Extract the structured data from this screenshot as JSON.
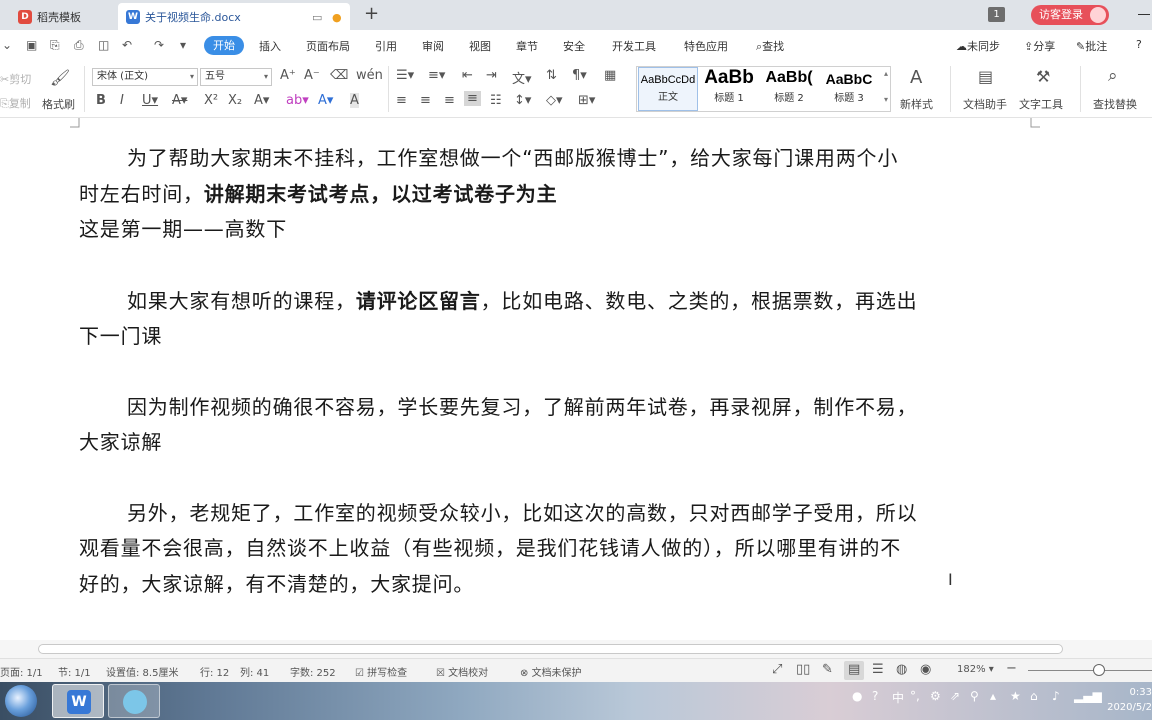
{
  "tabs": [
    {
      "label": "稻壳模板",
      "icon": "daoke-logo-icon",
      "color": "#e14b3f"
    },
    {
      "label": "关于视频生命.docx",
      "icon": "wps-writer-icon",
      "color": "#3778d6",
      "active": true
    }
  ],
  "titlebar": {
    "window_badge": "1",
    "guest_login": "访客登录"
  },
  "menu": {
    "items": [
      "开始",
      "插入",
      "页面布局",
      "引用",
      "审阅",
      "视图",
      "章节",
      "安全",
      "开发工具",
      "特色应用"
    ],
    "search_label": "查找",
    "right_items": [
      "未同步",
      "分享",
      "批注"
    ]
  },
  "ribbon": {
    "cut": "剪切",
    "copy": "复制",
    "format_painter": "格式刷",
    "font_name": "宋体 (正文)",
    "font_size": "五号",
    "styles": [
      {
        "sample": "AaBbCcDd",
        "name": "正文"
      },
      {
        "sample": "AaBb",
        "name": "标题 1"
      },
      {
        "sample": "AaBb(",
        "name": "标题 2"
      },
      {
        "sample": "AaBbC",
        "name": "标题 3"
      }
    ],
    "new_style": "新样式",
    "doc_assistant": "文档助手",
    "text_tools": "文字工具",
    "find_replace": "查找替换"
  },
  "document": {
    "p1_line1": "为了帮助大家期末不挂科，工作室想做一个“西邮版猴博士”，给大家每门课用两个小",
    "p1_line2_a": "时左右时间，",
    "p1_line2_b": "讲解期末考试考点，以过考试卷子为主",
    "p1_line3": "这是第一期——高数下",
    "p2_line1_a": "如果大家有想听的课程，",
    "p2_line1_b": "请评论区留言",
    "p2_line1_c": "，比如电路、数电、之类的，根据票数，再选出",
    "p2_line2": "下一门课",
    "p3_line1": "因为制作视频的确很不容易，学长要先复习，了解前两年试卷，再录视屏，制作不易，",
    "p3_line2": "大家谅解",
    "p4_line1": "另外，老规矩了，工作室的视频受众较小，比如这次的高数，只对西邮学子受用，所以",
    "p4_line2": "观看量不会很高，自然谈不上收益（有些视频，是我们花钱请人做的），所以哪里有讲的不",
    "p4_line3": "好的，大家谅解，有不清楚的，大家提问。"
  },
  "status": {
    "page": "页面: 1/1",
    "section": "节: 1/1",
    "setting": "设置值: 8.5厘米",
    "row": "行: 12",
    "col": "列: 41",
    "word_count": "字数: 252",
    "spell_check": "拼写检查",
    "doc_proof": "文档校对",
    "doc_protect": "文档未保护",
    "zoom": "182%",
    "zoom_fraction": 0.57
  },
  "taskbar": {
    "wps_letter": "W",
    "ime": "中",
    "time": "0:33",
    "date": "2020/5/2"
  },
  "colors": {
    "accent": "#3a8ee6",
    "guest_button": "#e7505a",
    "wps_blue": "#3778d6"
  }
}
